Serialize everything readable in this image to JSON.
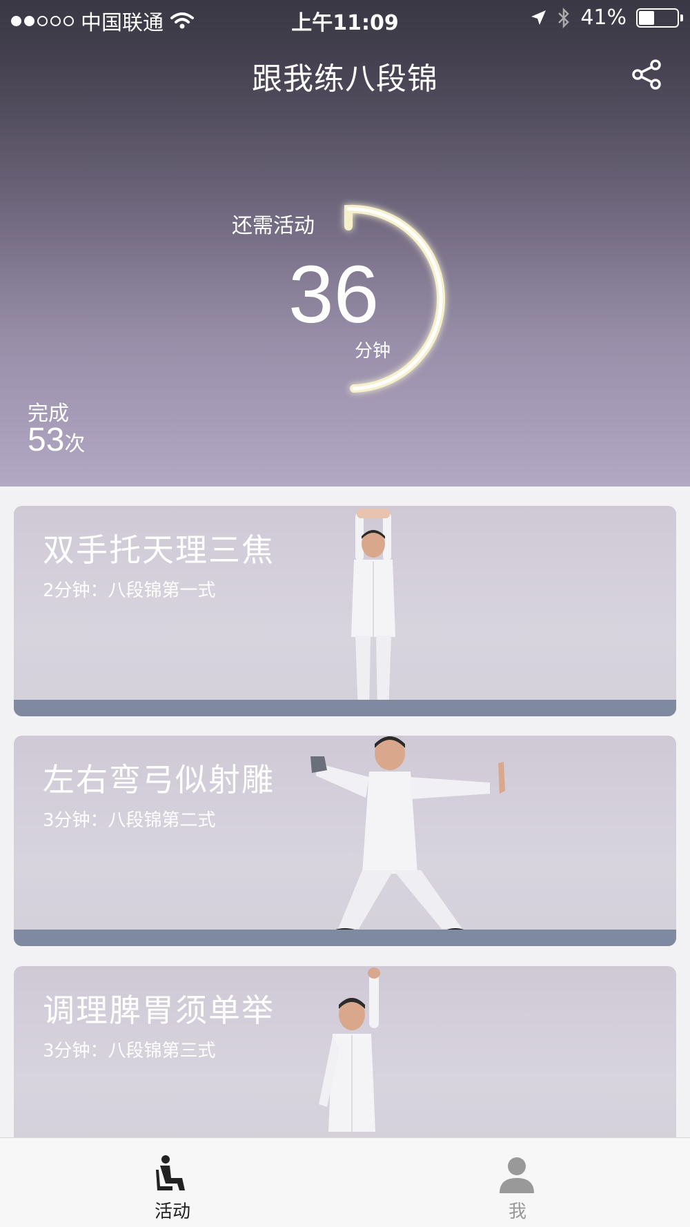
{
  "status_bar": {
    "carrier": "中国联通",
    "time": "上午11:09",
    "battery": "41%",
    "battery_level": 0.41,
    "signal_bars_filled": 2,
    "signal_bars_total": 5
  },
  "nav": {
    "title": "跟我练八段锦",
    "share_icon": "share-icon"
  },
  "summary": {
    "remaining_label": "还需活动",
    "remaining_value": "36",
    "remaining_unit": "分钟",
    "done_label": "完成",
    "done_count": "53",
    "done_unit": "次",
    "ring_color": "#f5efc8"
  },
  "exercises": [
    {
      "title": "双手托天理三焦",
      "subtitle": "2分钟：八段锦第一式"
    },
    {
      "title": "左右弯弓似射雕",
      "subtitle": "3分钟：八段锦第二式"
    },
    {
      "title": "调理脾胃须单举",
      "subtitle": "3分钟：八段锦第三式"
    }
  ],
  "tabbar": {
    "items": [
      {
        "label": "活动",
        "icon": "activity-icon",
        "active": true
      },
      {
        "label": "我",
        "icon": "profile-icon",
        "active": false
      }
    ]
  }
}
